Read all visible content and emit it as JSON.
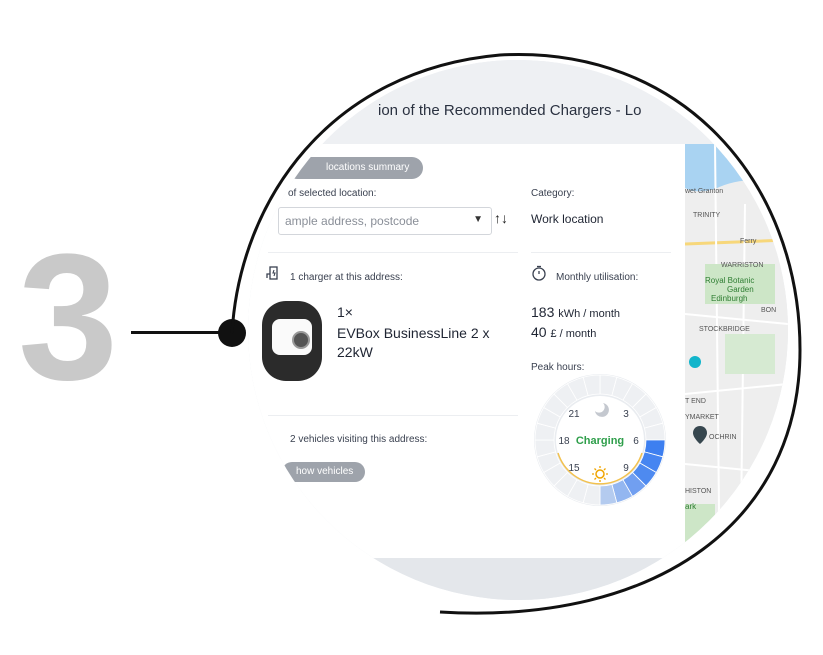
{
  "step_number": "3",
  "header": {
    "title": "ion of the Recommended Chargers - Lo"
  },
  "summary_button": "locations summary",
  "address": {
    "label": "of selected location:",
    "placeholder": "ample address, postcode",
    "sort_icon": "↑↓"
  },
  "category": {
    "label": "Category:",
    "value": "Work location"
  },
  "chargers": {
    "count_label": "1 charger at this address:",
    "quantity": "1×",
    "model": "EVBox BusinessLine 2 x 22kW"
  },
  "utilisation": {
    "label": "Monthly utilisation:",
    "energy_value": "183",
    "energy_unit": "kWh / month",
    "cost_value": "40",
    "cost_unit": "£ / month",
    "peak_label": "Peak hours:"
  },
  "gauge": {
    "center_label": "Charging",
    "hour_labels": [
      "21",
      "3",
      "18",
      "6",
      "15",
      "9"
    ],
    "accent_color": "#2e9e4a",
    "highlight_color": "#3d7ff0"
  },
  "vehicles": {
    "label": "2 vehicles visiting this address:",
    "button": "how vehicles"
  },
  "map": {
    "labels": [
      "wet Granton",
      "TRINITY",
      "Ferry",
      "WARRISTON",
      "Royal Botanic",
      "Garden",
      "Edinburgh",
      "BON",
      "STOCKBRIDGE",
      "T END",
      "YMARKET",
      "OCHRIN",
      "HISTON",
      "ark"
    ]
  }
}
